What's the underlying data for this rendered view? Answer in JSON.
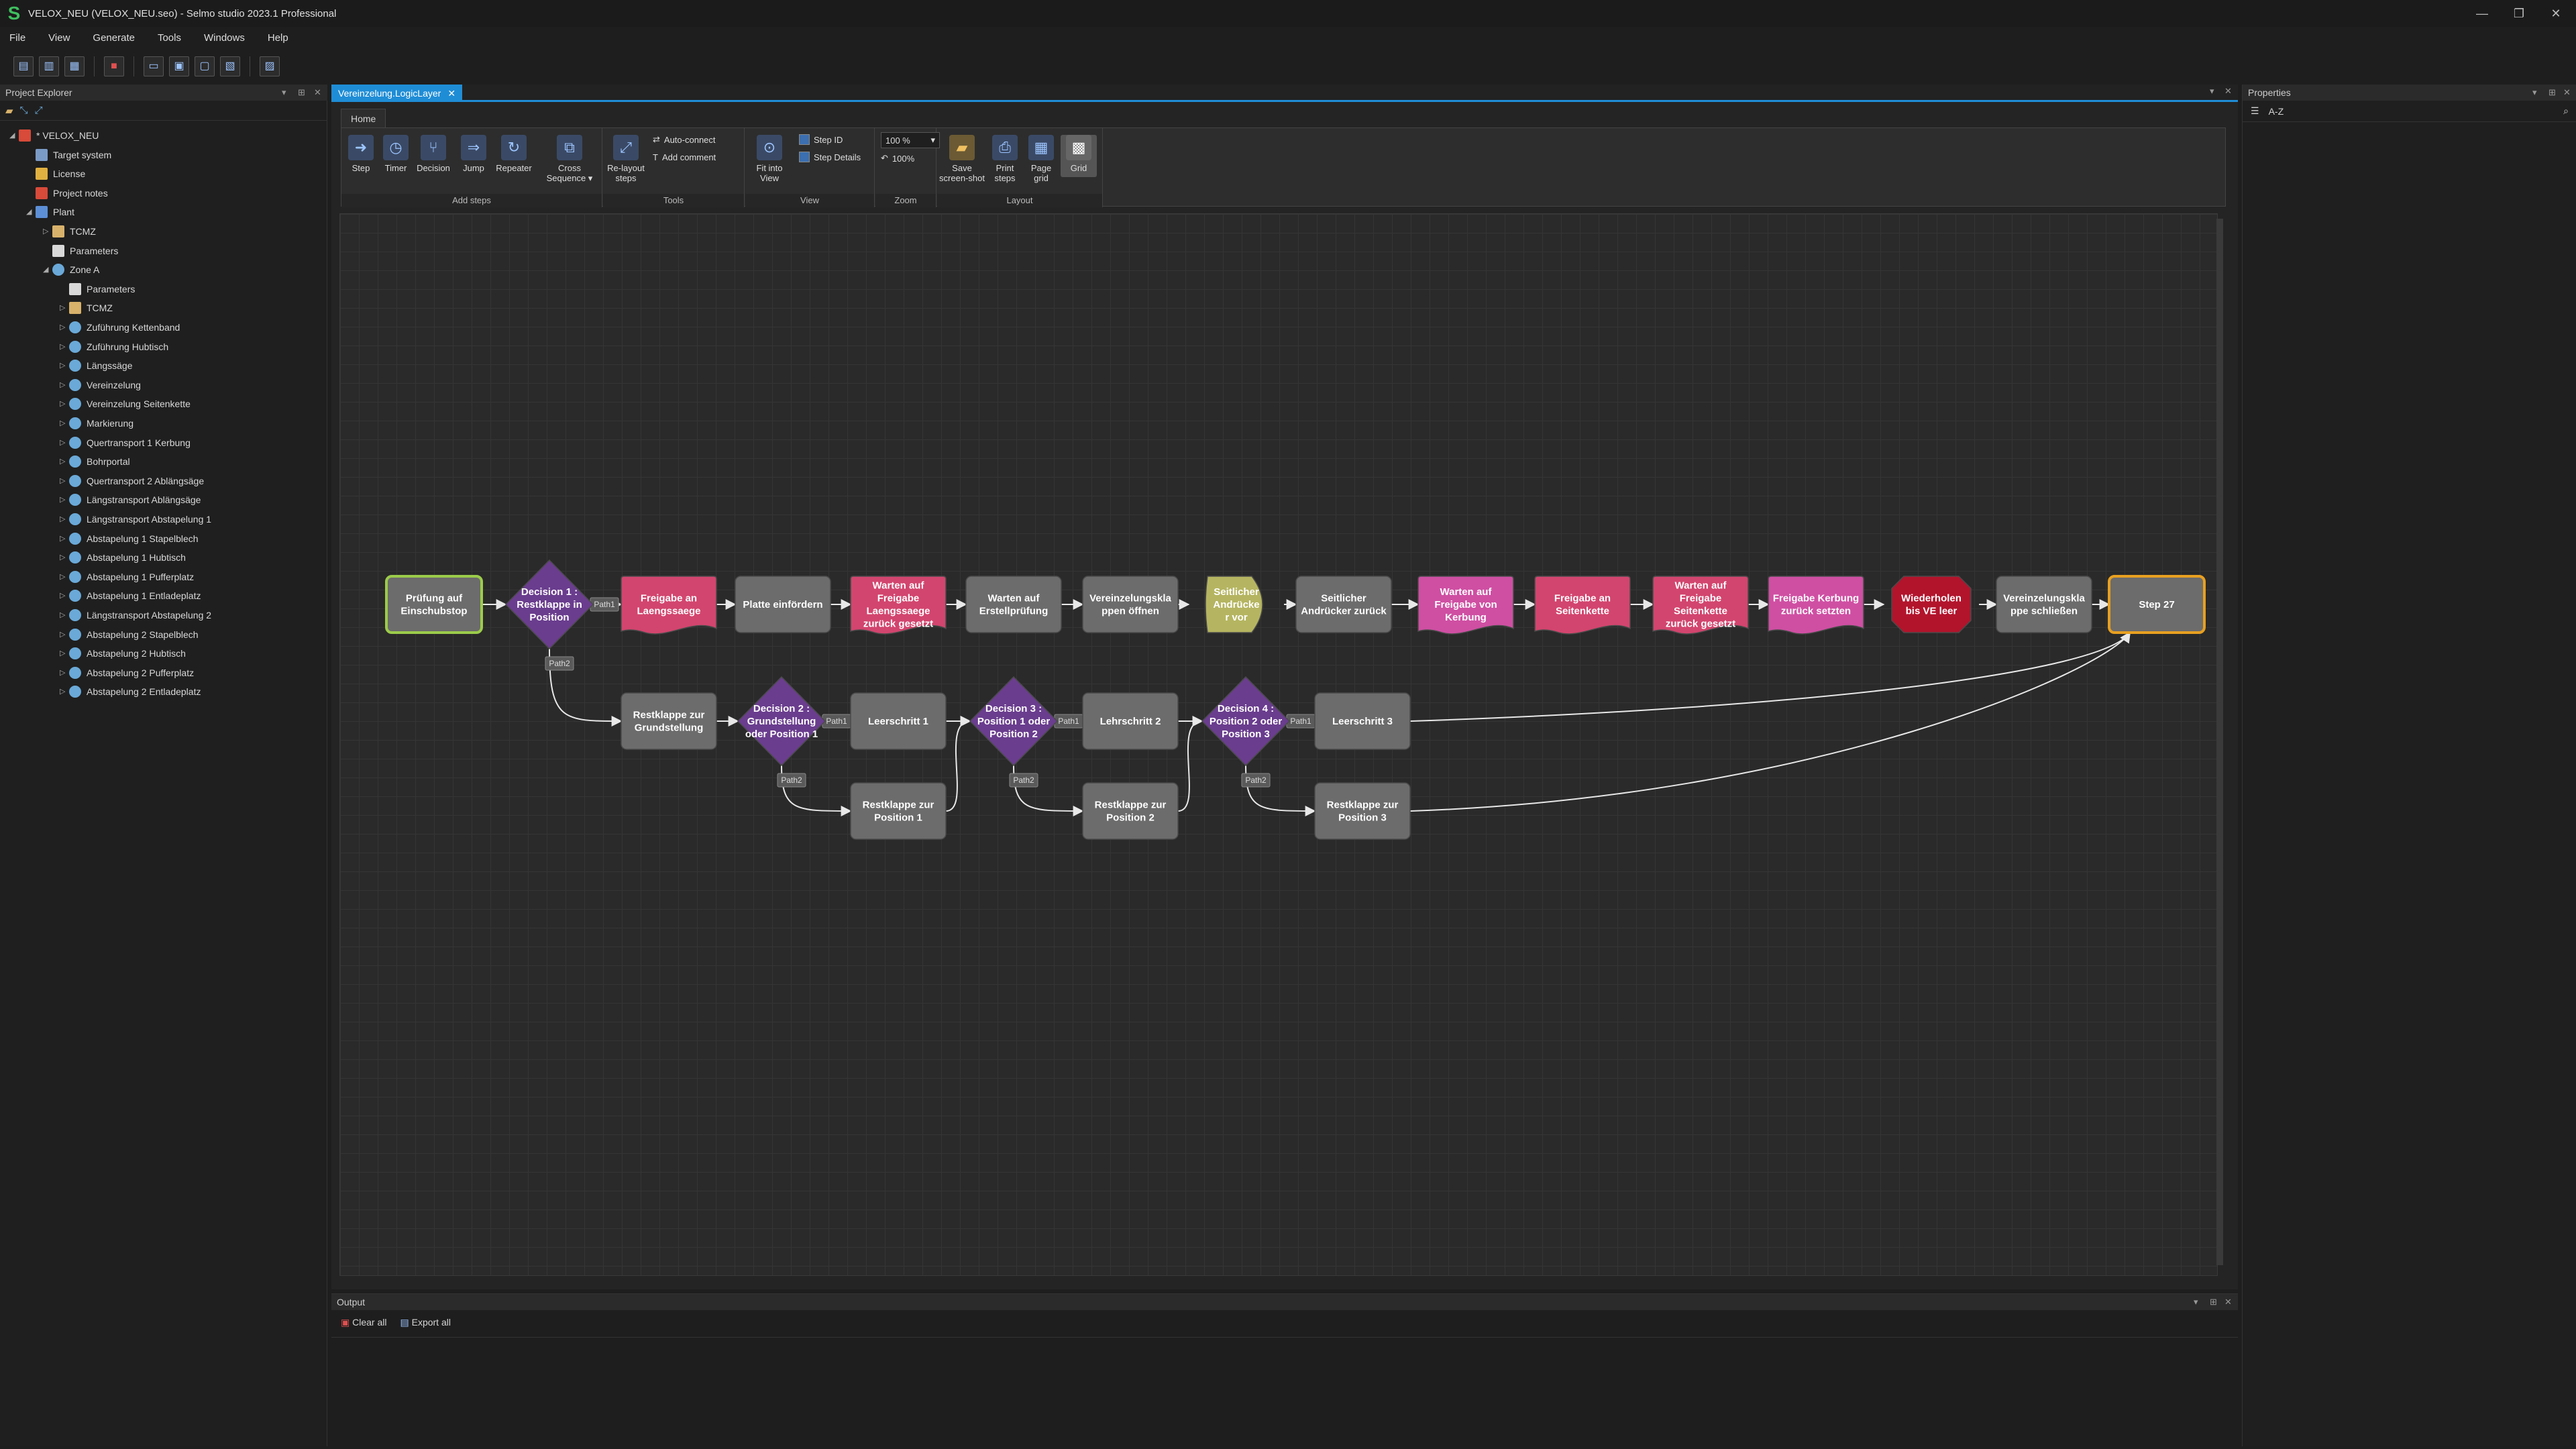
{
  "window": {
    "title": "VELOX_NEU (VELOX_NEU.seo) - Selmo studio 2023.1 Professional"
  },
  "menu": [
    "File",
    "View",
    "Generate",
    "Tools",
    "Windows",
    "Help"
  ],
  "explorer": {
    "title": "Project Explorer",
    "tree": [
      {
        "label": "* VELOX_NEU",
        "level": 0,
        "icon": "red",
        "arrow": "expanded"
      },
      {
        "label": "Target system",
        "level": 1,
        "icon": "target",
        "arrow": "none"
      },
      {
        "label": "License",
        "level": 1,
        "icon": "key",
        "arrow": "none"
      },
      {
        "label": "Project notes",
        "level": 1,
        "icon": "red",
        "arrow": "none"
      },
      {
        "label": "Plant",
        "level": 1,
        "icon": "plant",
        "arrow": "expanded"
      },
      {
        "label": "TCMZ",
        "level": 2,
        "icon": "folder",
        "arrow": "collapsed"
      },
      {
        "label": "Parameters",
        "level": 2,
        "icon": "doc",
        "arrow": "none"
      },
      {
        "label": "Zone A",
        "level": 2,
        "icon": "globe",
        "arrow": "expanded"
      },
      {
        "label": "Parameters",
        "level": 3,
        "icon": "doc",
        "arrow": "none"
      },
      {
        "label": "TCMZ",
        "level": 3,
        "icon": "folder",
        "arrow": "collapsed"
      },
      {
        "label": "Zuführung Kettenband",
        "level": 3,
        "icon": "globe",
        "arrow": "collapsed"
      },
      {
        "label": "Zuführung Hubtisch",
        "level": 3,
        "icon": "globe",
        "arrow": "collapsed"
      },
      {
        "label": "Längssäge",
        "level": 3,
        "icon": "globe",
        "arrow": "collapsed"
      },
      {
        "label": "Vereinzelung",
        "level": 3,
        "icon": "globe",
        "arrow": "collapsed"
      },
      {
        "label": "Vereinzelung Seitenkette",
        "level": 3,
        "icon": "globe",
        "arrow": "collapsed"
      },
      {
        "label": "Markierung",
        "level": 3,
        "icon": "globe",
        "arrow": "collapsed"
      },
      {
        "label": "Quertransport 1 Kerbung",
        "level": 3,
        "icon": "globe",
        "arrow": "collapsed"
      },
      {
        "label": "Bohrportal",
        "level": 3,
        "icon": "globe",
        "arrow": "collapsed"
      },
      {
        "label": "Quertransport 2 Ablängsäge",
        "level": 3,
        "icon": "globe",
        "arrow": "collapsed"
      },
      {
        "label": "Längstransport Ablängsäge",
        "level": 3,
        "icon": "globe",
        "arrow": "collapsed"
      },
      {
        "label": "Längstransport Abstapelung 1",
        "level": 3,
        "icon": "globe",
        "arrow": "collapsed"
      },
      {
        "label": "Abstapelung 1 Stapelblech",
        "level": 3,
        "icon": "globe",
        "arrow": "collapsed"
      },
      {
        "label": "Abstapelung 1 Hubtisch",
        "level": 3,
        "icon": "globe",
        "arrow": "collapsed"
      },
      {
        "label": "Abstapelung 1 Pufferplatz",
        "level": 3,
        "icon": "globe",
        "arrow": "collapsed"
      },
      {
        "label": "Abstapelung 1 Entladeplatz",
        "level": 3,
        "icon": "globe",
        "arrow": "collapsed"
      },
      {
        "label": "Längstransport Abstapelung 2",
        "level": 3,
        "icon": "globe",
        "arrow": "collapsed"
      },
      {
        "label": "Abstapelung 2 Stapelblech",
        "level": 3,
        "icon": "globe",
        "arrow": "collapsed"
      },
      {
        "label": "Abstapelung 2 Hubtisch",
        "level": 3,
        "icon": "globe",
        "arrow": "collapsed"
      },
      {
        "label": "Abstapelung 2 Pufferplatz",
        "level": 3,
        "icon": "globe",
        "arrow": "collapsed"
      },
      {
        "label": "Abstapelung 2 Entladeplatz",
        "level": 3,
        "icon": "globe",
        "arrow": "collapsed"
      }
    ]
  },
  "editor": {
    "tab": "Vereinzelung.LogicLayer",
    "ribbon_tab": "Home",
    "ribbon": {
      "add_steps": {
        "label": "Add steps",
        "step": "Step",
        "timer": "Timer",
        "decision": "Decision",
        "jump": "Jump",
        "repeater": "Repeater",
        "cross_sequence": "Cross Sequence ▾"
      },
      "tools": {
        "label": "Tools",
        "relayout": "Re-layout steps",
        "auto_connect": "Auto-connect",
        "add_comment": "Add comment"
      },
      "view": {
        "label": "View",
        "fit": "Fit into View",
        "step_id": "Step ID",
        "step_details": "Step Details"
      },
      "zoom": {
        "label": "Zoom",
        "value": "100 %",
        "reset": "100%"
      },
      "layout": {
        "label": "Layout",
        "save": "Save screen-shot",
        "print": "Print steps",
        "page_grid": "Page grid",
        "grid": "Grid"
      }
    }
  },
  "diagram": {
    "nodes": [
      {
        "id": "n1",
        "lines": [
          "Prüfung auf",
          "Einschubstop"
        ],
        "shape": "rect",
        "fill": "#6c6c6c",
        "stroke": "#9ccc4a"
      },
      {
        "id": "d1",
        "lines": [
          "Decision 1 :",
          "Restklappe in",
          "Position"
        ],
        "shape": "diamond",
        "fill": "#6a3d8e"
      },
      {
        "id": "n2",
        "lines": [
          "Freigabe an",
          "Laengssaege"
        ],
        "shape": "wave",
        "fill": "#d2456e"
      },
      {
        "id": "n3",
        "lines": [
          "Platte einfördern"
        ],
        "shape": "rect",
        "fill": "#6c6c6c"
      },
      {
        "id": "n4",
        "lines": [
          "Warten auf",
          "Freigabe",
          "Laengssaege",
          "zurück gesetzt"
        ],
        "shape": "wave",
        "fill": "#d2456e"
      },
      {
        "id": "n5",
        "lines": [
          "Warten auf",
          "Erstellprüfung"
        ],
        "shape": "rect",
        "fill": "#6c6c6c"
      },
      {
        "id": "n6",
        "lines": [
          "Vereinzelungskla",
          "ppen öffnen"
        ],
        "shape": "rect",
        "fill": "#6c6c6c"
      },
      {
        "id": "n7",
        "lines": [
          "Seitlicher",
          "Andrücke",
          "r vor"
        ],
        "shape": "pill",
        "fill": "#b5b561"
      },
      {
        "id": "n8",
        "lines": [
          "Seitlicher",
          "Andrücker zurück"
        ],
        "shape": "rect",
        "fill": "#6c6c6c"
      },
      {
        "id": "n9",
        "lines": [
          "Warten auf",
          "Freigabe von",
          "Kerbung"
        ],
        "shape": "wave",
        "fill": "#cf4fa3"
      },
      {
        "id": "n10",
        "lines": [
          "Freigabe an",
          "Seitenkette"
        ],
        "shape": "wave",
        "fill": "#d2456e"
      },
      {
        "id": "n11",
        "lines": [
          "Warten auf",
          "Freigabe",
          "Seitenkette",
          "zurück gesetzt"
        ],
        "shape": "wave",
        "fill": "#d2456e"
      },
      {
        "id": "n12",
        "lines": [
          "Freigabe Kerbung",
          "zurück setzten"
        ],
        "shape": "wave",
        "fill": "#cf4fa3"
      },
      {
        "id": "n13",
        "lines": [
          "Wiederholen",
          "bis VE leer"
        ],
        "shape": "octagon",
        "fill": "#b2142c"
      },
      {
        "id": "n14",
        "lines": [
          "Vereinzelungskla",
          "ppe schließen"
        ],
        "shape": "rect",
        "fill": "#6c6c6c"
      },
      {
        "id": "n15",
        "lines": [
          "Step 27"
        ],
        "shape": "rect",
        "fill": "#6c6c6c",
        "stroke": "#e8a020"
      },
      {
        "id": "r1",
        "lines": [
          "Restklappe zur",
          "Grundstellung"
        ],
        "shape": "rect",
        "fill": "#6c6c6c"
      },
      {
        "id": "d2",
        "lines": [
          "Decision 2 :",
          "Grundstellung",
          "oder Position 1"
        ],
        "shape": "diamond",
        "fill": "#6a3d8e"
      },
      {
        "id": "l1",
        "lines": [
          "Leerschritt 1"
        ],
        "shape": "rect",
        "fill": "#6c6c6c"
      },
      {
        "id": "d3",
        "lines": [
          "Decision 3 :",
          "Position 1 oder",
          "Position 2"
        ],
        "shape": "diamond",
        "fill": "#6a3d8e"
      },
      {
        "id": "l2",
        "lines": [
          "Lehrschritt 2"
        ],
        "shape": "rect",
        "fill": "#6c6c6c"
      },
      {
        "id": "d4",
        "lines": [
          "Decision 4 :",
          "Position 2 oder",
          "Position 3"
        ],
        "shape": "diamond",
        "fill": "#6a3d8e"
      },
      {
        "id": "l3",
        "lines": [
          "Leerschritt 3"
        ],
        "shape": "rect",
        "fill": "#6c6c6c"
      },
      {
        "id": "p1",
        "lines": [
          "Restklappe zur",
          "Position 1"
        ],
        "shape": "rect",
        "fill": "#6c6c6c"
      },
      {
        "id": "p2",
        "lines": [
          "Restklappe zur",
          "Position 2"
        ],
        "shape": "rect",
        "fill": "#6c6c6c"
      },
      {
        "id": "p3",
        "lines": [
          "Restklappe zur",
          "Position 3"
        ],
        "shape": "rect",
        "fill": "#6c6c6c"
      }
    ],
    "edges": [
      {
        "from": "n1",
        "to": "d1"
      },
      {
        "from": "d1",
        "to": "n2",
        "label": "Path1"
      },
      {
        "from": "n2",
        "to": "n3"
      },
      {
        "from": "n3",
        "to": "n4"
      },
      {
        "from": "n4",
        "to": "n5"
      },
      {
        "from": "n5",
        "to": "n6"
      },
      {
        "from": "n6",
        "to": "n7"
      },
      {
        "from": "n7",
        "to": "n8"
      },
      {
        "from": "n8",
        "to": "n9"
      },
      {
        "from": "n9",
        "to": "n10"
      },
      {
        "from": "n10",
        "to": "n11"
      },
      {
        "from": "n11",
        "to": "n12"
      },
      {
        "from": "n12",
        "to": "n13"
      },
      {
        "from": "n13",
        "to": "n14"
      },
      {
        "from": "n14",
        "to": "n15"
      },
      {
        "from": "d1",
        "to": "r1",
        "label": "Path2"
      },
      {
        "from": "r1",
        "to": "d2"
      },
      {
        "from": "d2",
        "to": "l1",
        "label": "Path1"
      },
      {
        "from": "d2",
        "to": "p1",
        "label": "Path2"
      },
      {
        "from": "l1",
        "to": "d3"
      },
      {
        "from": "p1",
        "to": "d3"
      },
      {
        "from": "d3",
        "to": "l2",
        "label": "Path1"
      },
      {
        "from": "d3",
        "to": "p2",
        "label": "Path2"
      },
      {
        "from": "l2",
        "to": "d4"
      },
      {
        "from": "p2",
        "to": "d4"
      },
      {
        "from": "d4",
        "to": "l3",
        "label": "Path1"
      },
      {
        "from": "d4",
        "to": "p3",
        "label": "Path2"
      },
      {
        "from": "l3",
        "to": "n15"
      },
      {
        "from": "p3",
        "to": "n15"
      }
    ]
  },
  "output": {
    "title": "Output",
    "clear_all": "Clear all",
    "export_all": "Export all"
  },
  "properties": {
    "title": "Properties",
    "sort": "A-Z"
  }
}
